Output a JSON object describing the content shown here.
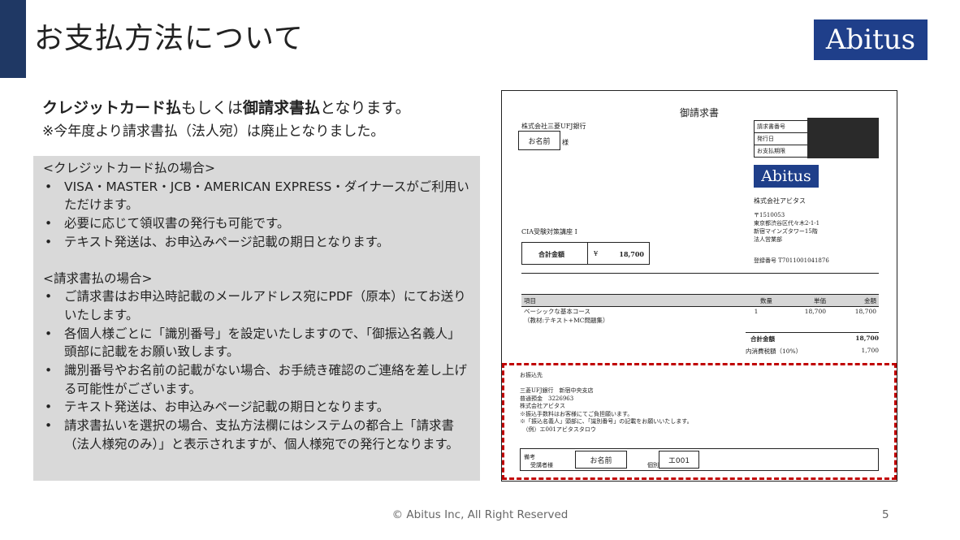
{
  "slide": {
    "title": "お支払方法について",
    "logo": "Abitus",
    "intro": {
      "line1_b1": "クレジットカード払",
      "line1_t1": "もしくは",
      "line1_b2": "御請求書払",
      "line1_t2": "となります。",
      "line2": "※今年度より請求書払（法人宛）は廃止となりました。"
    },
    "credit": {
      "heading": "<クレジットカード払の場合>",
      "items": [
        "VISA・MASTER・JCB・AMERICAN EXPRESS・ダイナースがご利用いただけます。",
        "必要に応じて領収書の発行も可能です。",
        "テキスト発送は、お申込みページ記載の期日となります。"
      ]
    },
    "invoice_pay": {
      "heading": "<請求書払の場合>",
      "items": [
        "ご請求書はお申込時記載のメールアドレス宛にPDF（原本）にてお送りいたします。",
        "各個人様ごとに「識別番号」を設定いたしますので、「御振込名義人」頭部に記載をお願い致します。",
        "識別番号やお名前の記載がない場合、お手続き確認のご連絡を差し上げる可能性がございます。",
        "テキスト発送は、お申込みページ記載の期日となります。",
        "請求書払いを選択の場合、支払方法欄にはシステムの都合上「請求書（法人様宛のみ）」と表示されますが、個人様宛での発行となります。"
      ]
    },
    "footer": "© Abitus Inc, All Right Reserved",
    "page_number": "5"
  },
  "invoice": {
    "title": "御請求書",
    "bank": "株式会社三菱UFJ銀行",
    "name_placeholder": "お名前",
    "sama": "様",
    "info_labels": [
      "請求書番号",
      "発行日",
      "お支払期限"
    ],
    "logo": "Abitus",
    "company": "株式会社アビタス",
    "address": [
      "〒1510053",
      "東京都渋谷区代々木2-1-1",
      "新宿マインズタワー15階",
      "法人営業部"
    ],
    "course": "CIA受験対策講座 I",
    "total_label": "合計金額",
    "yen": "¥",
    "total_amount": "18,700",
    "reg_no": "登録番号 T7011001041876",
    "item_headers": [
      "項目",
      "数量",
      "単価",
      "金額"
    ],
    "item_row": [
      "ベーシックな基本コース",
      "1",
      "18,700",
      "18,700"
    ],
    "item_sub": "（教材:テキスト+MC問題集）",
    "sum_label": "合計金額",
    "sum_value": "18,700",
    "tax_label": "内消費税額（10%）",
    "tax_value": "1,700",
    "pay_lines": [
      "お振込先",
      "",
      "三菱UFJ銀行　新宿中央支店",
      "普通預金　3226963",
      "株式会社アビタス",
      "※振込手数料はお客様にてご負担願います。",
      "※「振込名義人」頭部に、「識別番号」の記載をお願いいたします。",
      "　（例）エ001アビタスタロウ"
    ],
    "note_label": "備考",
    "note_person": "受講者様",
    "note_id_label": "個別番号",
    "note_name": "お名前",
    "note_id": "エ001"
  }
}
